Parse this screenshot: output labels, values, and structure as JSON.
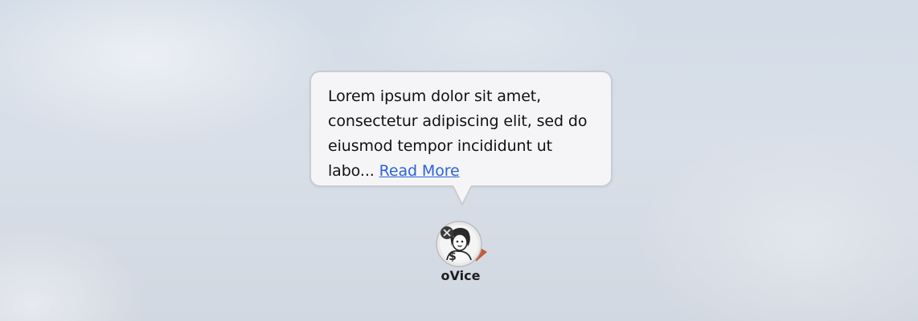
{
  "tooltip": {
    "text": "Lorem ipsum dolor sit amet, consectetur adipiscing elit, sed do eiusmod tempor incididunt ut labo...",
    "link_label": "Read More"
  },
  "desktop_icon": {
    "label": "oVice",
    "icon": "ovice-app-icon"
  },
  "colors": {
    "link": "#2d63d8",
    "bubble_bg": "#f5f5f7",
    "bubble_border": "#c9ccd2"
  }
}
